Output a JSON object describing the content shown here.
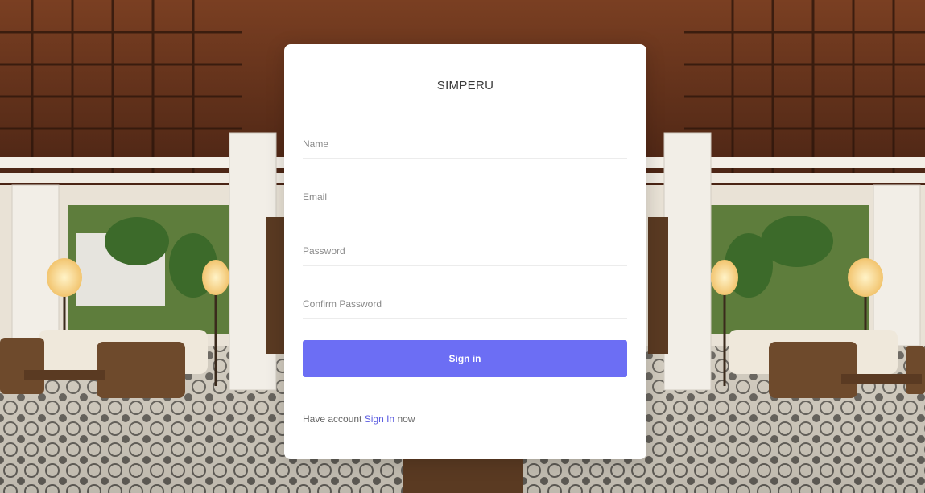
{
  "app": {
    "title": "SIMPERU"
  },
  "form": {
    "name_placeholder": "Name",
    "email_placeholder": "Email",
    "password_placeholder": "Password",
    "confirm_password_placeholder": "Confirm Password",
    "submit_label": "Sign in"
  },
  "footer": {
    "prefix": "Have account",
    "link_label": "Sign In",
    "suffix": "now"
  },
  "colors": {
    "accent": "#6c6ef4",
    "link": "#5b5ce0",
    "card": "#ffffff"
  }
}
